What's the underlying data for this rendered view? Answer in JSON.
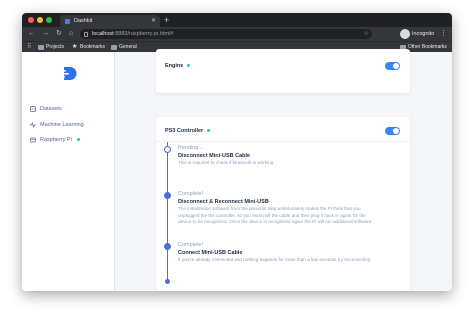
{
  "browser": {
    "tab_title": "Dashkit",
    "url_host": "localhost",
    "url_path": ":8883/raspberry-pi.html#",
    "profile_label": "Incognito",
    "bookmarks": [
      "Projects",
      "Bookmarks",
      "General"
    ],
    "other_bookmarks": "Other Bookmarks",
    "colors": {
      "close": "#ff5f57",
      "minimize": "#febc2e",
      "maximize": "#28c840"
    }
  },
  "sidebar": {
    "items": [
      {
        "label": "Datasets",
        "icon": "database-icon"
      },
      {
        "label": "Machine Learning",
        "icon": "activity-icon"
      },
      {
        "label": "Raspberry Pi",
        "icon": "chip-icon",
        "status": "online"
      }
    ]
  },
  "engine": {
    "title": "Engine",
    "enabled": true
  },
  "controller": {
    "title": "PS3 Controller",
    "enabled": true,
    "steps": [
      {
        "status": "Pending...",
        "title": "Disconnect Mini-USB Cable",
        "description": "This is required to check if bluetooth is working"
      },
      {
        "status": "Complete!",
        "title": "Disconnect & Reconnect Mini-USB",
        "description_lines": [
          "The initialization software from the previous step unfortunately makes the Pi think that you",
          "unplugged the the controller, so you must pull the cable and then plug it back in again for the",
          "device to be recognized. Once the device is recognized again the Pi will run additional software."
        ]
      },
      {
        "status": "Complete!",
        "title": "Connect Mini-USB Cable",
        "description": "If you're already connected and nothing happens for more than a few seconds try reconnecting"
      }
    ]
  },
  "accent_color": "#3b82f6",
  "status_color": "#2ec9a0"
}
